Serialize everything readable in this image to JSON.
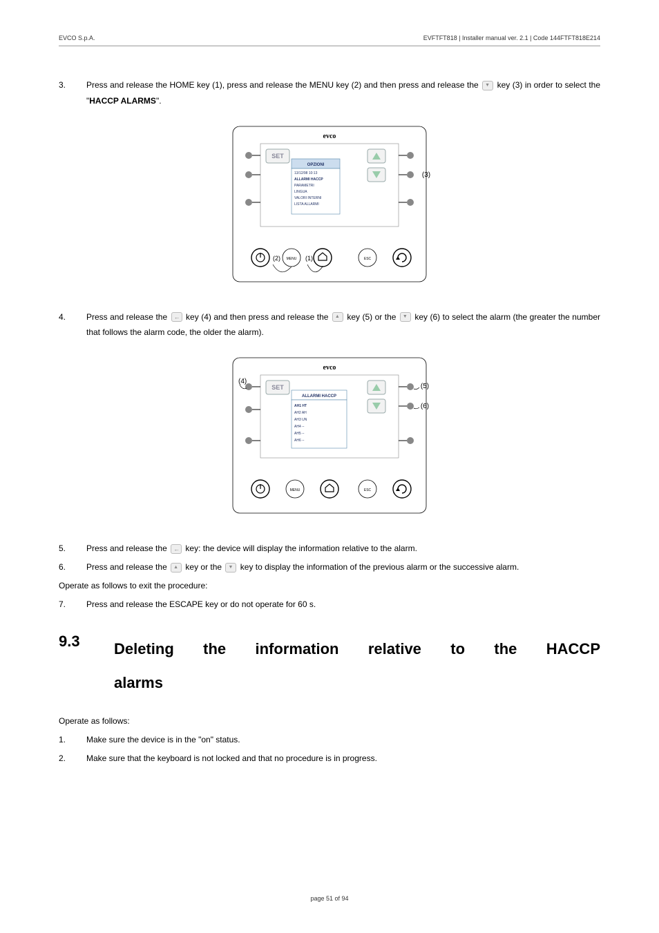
{
  "header": {
    "left": "EVCO S.p.A.",
    "right": "EVFTFT818 | Installer manual ver. 2.1 | Code 144FTFT818E214"
  },
  "steps1": {
    "s3": {
      "num": "3.",
      "text_a": "Press and release the HOME key (1), press and release the MENU key (2) and then press and release the ",
      "text_b": " key (3) in order to select the \"",
      "text_c": "HACCP ALARMS",
      "text_d": "\"."
    }
  },
  "fig1": {
    "brand": "evco",
    "set": "SET",
    "opzioni": "OPZIONI",
    "items": [
      "13/12/98 10:13",
      "ALLARMI HACCP",
      "PARAMETRI",
      "LINGUA",
      "VALORI INTERNI",
      "LISTA ALLARMI"
    ],
    "callout3": "(3)",
    "callout2": "(2)",
    "callout1": "(1)",
    "esc": "ESC",
    "menu": "MENU"
  },
  "steps2": {
    "s4": {
      "num": "4.",
      "text_a": "Press and release the ",
      "text_b": " key (4) and then press and release the ",
      "text_c": " key (5) or the ",
      "text_d": " key (6) to select the alarm (the greater the number that follows the alarm code, the older the alarm)."
    }
  },
  "fig2": {
    "brand": "evco",
    "set": "SET",
    "title": "ALLARMI HACCP",
    "items": [
      "AH1 HT",
      "AH2 AH",
      "AH3 UN",
      "AH4 --",
      "AH5 --",
      "AH6 --"
    ],
    "callout4": "(4)",
    "callout5": "(5)",
    "callout6": "(6)",
    "esc": "ESC",
    "menu": "MENU"
  },
  "steps3": {
    "s5": {
      "num": "5.",
      "text_a": "Press and release the ",
      "text_b": " key: the device will display the information relative to the alarm."
    },
    "s6": {
      "num": "6.",
      "text_a": "Press and release the ",
      "text_b": " key or the ",
      "text_c": " key to display the information of the previous alarm or the successive alarm."
    },
    "exit_intro": "Operate as follows to exit the procedure:",
    "s7": {
      "num": "7.",
      "text": "Press and release the ESCAPE key or do not operate for 60 s."
    }
  },
  "section": {
    "num": "9.3",
    "title_line1": "Deleting the information relative to the HACCP",
    "title_line2": "alarms"
  },
  "steps4": {
    "intro": "Operate as follows:",
    "s1": {
      "num": "1.",
      "text": "Make sure the device is in the \"on\" status."
    },
    "s2": {
      "num": "2.",
      "text": "Make sure that the keyboard is not locked and that no procedure is in progress."
    }
  },
  "footer": "page 51 of 94"
}
